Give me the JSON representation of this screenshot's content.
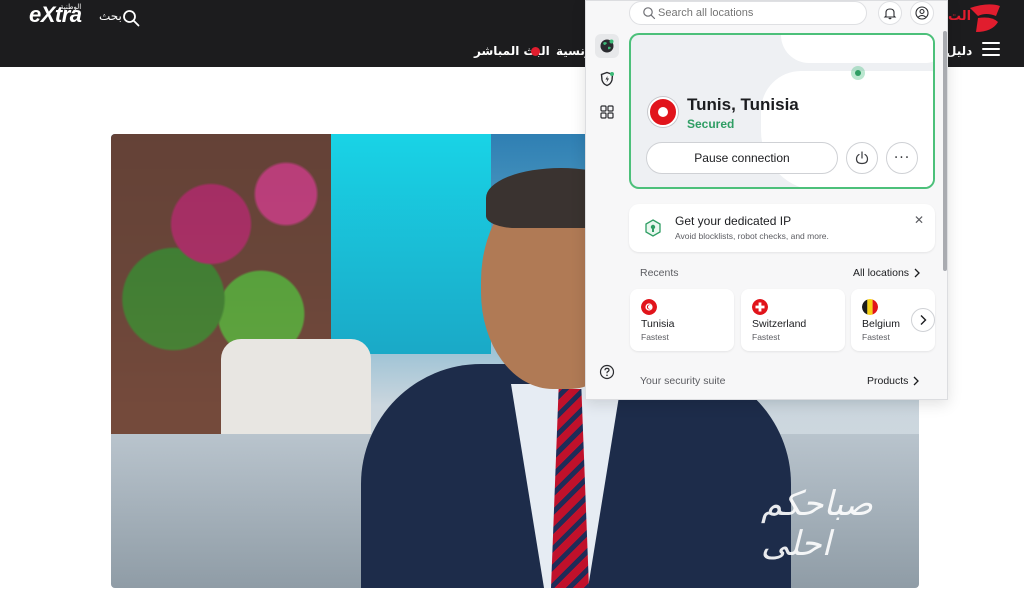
{
  "site": {
    "logo": "eXtra",
    "logo_small": "الوطنية",
    "search_label": "بحث",
    "nav_live": "البث المباشر",
    "nav_item_2": "ونسية",
    "nav_item_guide": "دليل",
    "brand_right": "الت",
    "colors": {
      "header_bg": "#1c1c1e",
      "live_red": "#e11d2e"
    }
  },
  "hero": {
    "watermark": "صباحكم احلى"
  },
  "vpn": {
    "search": {
      "placeholder": "Search all locations"
    },
    "connection": {
      "location": "Tunis, Tunisia",
      "status": "Secured",
      "pause_label": "Pause connection",
      "more_label": "···"
    },
    "promo": {
      "title": "Get your dedicated IP",
      "subtitle": "Avoid blocklists, robot checks, and more.",
      "close": "✕"
    },
    "recents": {
      "label": "Recents",
      "all_locations": "All locations",
      "items": [
        {
          "country": "Tunisia",
          "sub": "Fastest",
          "flag": "tunisia-flag-icon"
        },
        {
          "country": "Switzerland",
          "sub": "Fastest",
          "flag": "switzerland-flag-icon"
        },
        {
          "country": "Belgium",
          "sub": "Fastest",
          "flag": "belgium-flag-icon"
        }
      ]
    },
    "suite": {
      "label": "Your security suite",
      "products": "Products"
    },
    "icons": {
      "rail": [
        "globe-icon",
        "shield-icon",
        "apps-grid-icon",
        "help-icon"
      ],
      "header": [
        "search-icon",
        "bell-icon",
        "user-icon"
      ]
    },
    "colors": {
      "accent_green": "#4cc07a",
      "secured_green": "#2f9e64"
    }
  }
}
